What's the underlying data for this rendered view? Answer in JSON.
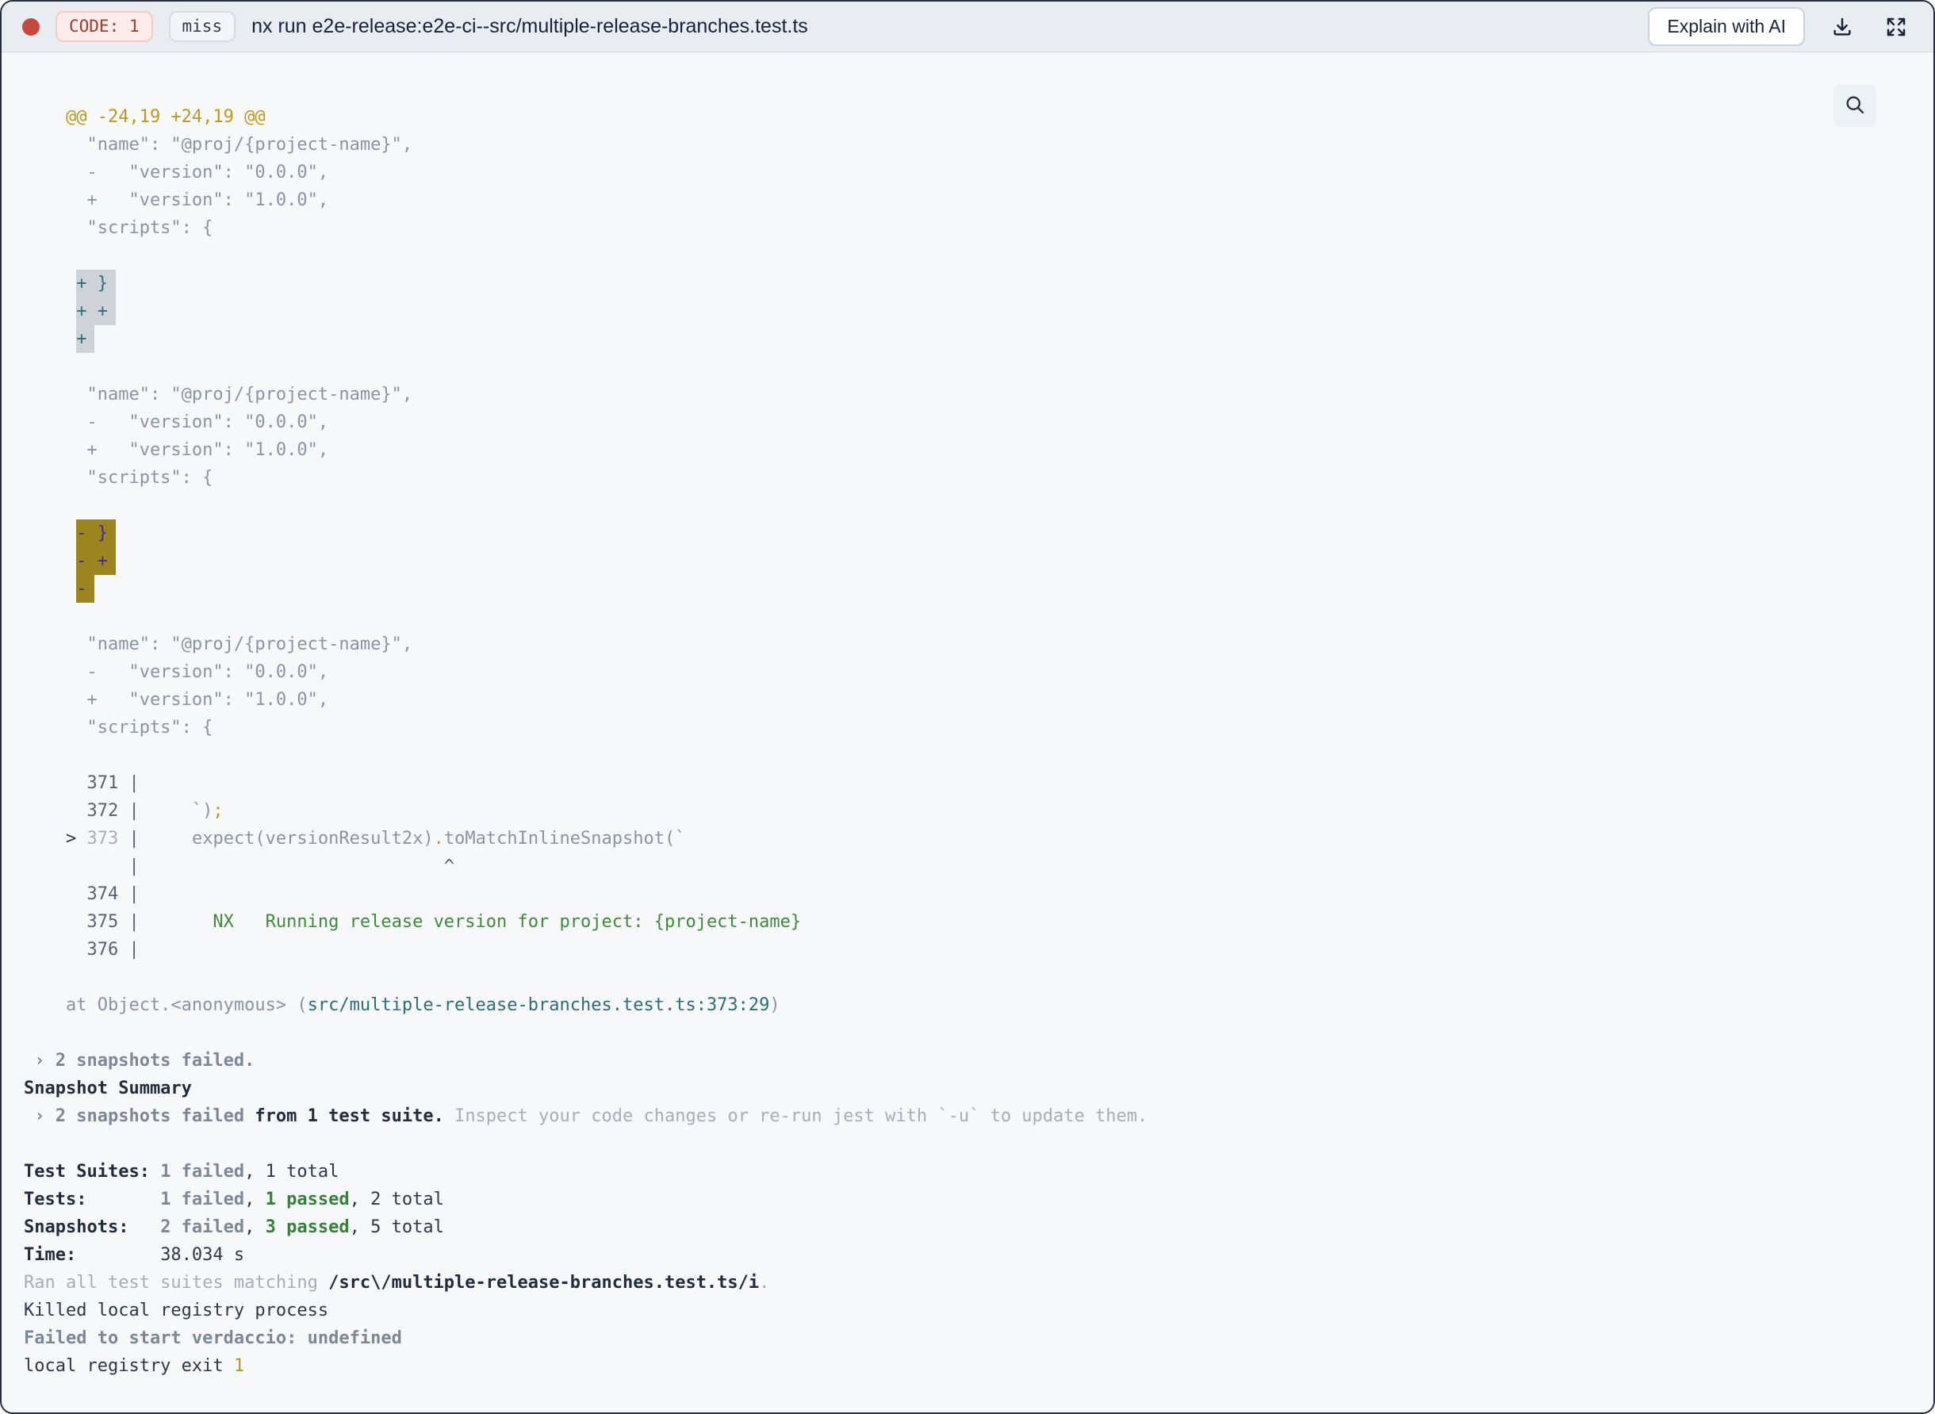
{
  "header": {
    "code_badge": "CODE: 1",
    "cache_badge": "miss",
    "title": "nx run e2e-release:e2e-ci--src/multiple-release-branches.test.ts",
    "explain_button": "Explain with AI",
    "status_dot_color": "#c6483e"
  },
  "colors": {
    "header_bg": "#e9edf2",
    "terminal_bg": "#f7f8fa",
    "diff_yellow": "#bd9821",
    "pass_green": "#35803a",
    "link_teal": "#2c6d78",
    "match_highlight_bg": "#ced3da",
    "active_match_highlight_bg": "#9c8420",
    "badge_red_text": "#9e3a30"
  },
  "terminal": {
    "lines": [
      {
        "name": "diff-hunk-header",
        "s": [
          {
            "t": "    @@ -24,19 +24,19 @@",
            "c": "y"
          }
        ]
      },
      {
        "name": "diff-line",
        "s": [
          {
            "t": "      \"name\": \"@proj/{project-name}\",",
            "c": "g"
          }
        ]
      },
      {
        "name": "diff-line",
        "s": [
          {
            "t": "      -   \"version\": \"0.0.0\",",
            "c": "g"
          }
        ]
      },
      {
        "name": "diff-line",
        "s": [
          {
            "t": "      +   \"version\": \"1.0.0\",",
            "c": "g"
          }
        ]
      },
      {
        "name": "diff-line",
        "s": [
          {
            "t": "      \"scripts\": {",
            "c": "g"
          }
        ]
      },
      {
        "name": "blank-line",
        "s": []
      },
      {
        "name": "search-match-line",
        "s": [
          {
            "t": "     ",
            "c": "g"
          },
          {
            "t": "+ }",
            "c": "hlg"
          }
        ]
      },
      {
        "name": "search-match-line",
        "s": [
          {
            "t": "     ",
            "c": "g"
          },
          {
            "t": "+ +",
            "c": "hlg"
          }
        ]
      },
      {
        "name": "search-match-line",
        "s": [
          {
            "t": "     ",
            "c": "g"
          },
          {
            "t": "+",
            "c": "hlg"
          }
        ]
      },
      {
        "name": "blank-line",
        "s": []
      },
      {
        "name": "diff-line",
        "s": [
          {
            "t": "      \"name\": \"@proj/{project-name}\",",
            "c": "g"
          }
        ]
      },
      {
        "name": "diff-line",
        "s": [
          {
            "t": "      -   \"version\": \"0.0.0\",",
            "c": "g"
          }
        ]
      },
      {
        "name": "diff-line",
        "s": [
          {
            "t": "      +   \"version\": \"1.0.0\",",
            "c": "g"
          }
        ]
      },
      {
        "name": "diff-line",
        "s": [
          {
            "t": "      \"scripts\": {",
            "c": "g"
          }
        ]
      },
      {
        "name": "blank-line",
        "s": []
      },
      {
        "name": "active-search-match-line",
        "s": [
          {
            "t": "     ",
            "c": "g"
          },
          {
            "t": "- }",
            "c": "hlo"
          }
        ]
      },
      {
        "name": "active-search-match-line",
        "s": [
          {
            "t": "     ",
            "c": "g"
          },
          {
            "t": "- +",
            "c": "hlo"
          }
        ]
      },
      {
        "name": "active-search-match-line",
        "s": [
          {
            "t": "     ",
            "c": "g"
          },
          {
            "t": "-",
            "c": "hlo"
          }
        ]
      },
      {
        "name": "blank-line",
        "s": []
      },
      {
        "name": "diff-line",
        "s": [
          {
            "t": "      \"name\": \"@proj/{project-name}\",",
            "c": "g"
          }
        ]
      },
      {
        "name": "diff-line",
        "s": [
          {
            "t": "      -   \"version\": \"0.0.0\",",
            "c": "g"
          }
        ]
      },
      {
        "name": "diff-line",
        "s": [
          {
            "t": "      +   \"version\": \"1.0.0\",",
            "c": "g"
          }
        ]
      },
      {
        "name": "diff-line",
        "s": [
          {
            "t": "      \"scripts\": {",
            "c": "g"
          }
        ]
      },
      {
        "name": "blank-line",
        "s": []
      },
      {
        "name": "code-frame-line",
        "s": [
          {
            "t": "      371 |",
            "c": "ln"
          }
        ]
      },
      {
        "name": "code-frame-line",
        "s": [
          {
            "t": "      372 |",
            "c": "ln"
          },
          {
            "t": "     `)",
            "c": "g"
          },
          {
            "t": ";",
            "c": "y"
          }
        ]
      },
      {
        "name": "code-frame-error-line",
        "s": [
          {
            "t": "    > ",
            "c": "d"
          },
          {
            "t": "373",
            "c": "dim"
          },
          {
            "t": " |",
            "c": "ln"
          },
          {
            "t": "     expect(versionResult2x)",
            "c": "g"
          },
          {
            "t": ".",
            "c": "y"
          },
          {
            "t": "toMatchInlineSnapshot(`",
            "c": "g"
          }
        ]
      },
      {
        "name": "code-frame-caret-line",
        "s": [
          {
            "t": "          |                             ^",
            "c": "ln"
          }
        ]
      },
      {
        "name": "code-frame-line",
        "s": [
          {
            "t": "      374 |",
            "c": "ln"
          }
        ]
      },
      {
        "name": "code-frame-line",
        "s": [
          {
            "t": "      375 |",
            "c": "ln"
          },
          {
            "t": "       NX   Running release version for project: {project-name}",
            "c": "gr"
          }
        ]
      },
      {
        "name": "code-frame-line",
        "s": [
          {
            "t": "      376 |",
            "c": "ln"
          }
        ]
      },
      {
        "name": "blank-line",
        "s": []
      },
      {
        "name": "stack-trace-line",
        "s": [
          {
            "t": "    at Object.<anonymous> (",
            "c": "g"
          },
          {
            "t": "src/multiple-release-branches.test.ts:373:29",
            "c": "t"
          },
          {
            "t": ")",
            "c": "g"
          }
        ]
      },
      {
        "name": "blank-line",
        "s": []
      },
      {
        "name": "snapshots-failed-line",
        "s": [
          {
            "t": " › 2 snapshots failed.",
            "c": "gb"
          }
        ]
      },
      {
        "name": "snapshot-summary-heading",
        "s": [
          {
            "t": "Snapshot Summary",
            "c": "db"
          }
        ]
      },
      {
        "name": "snapshot-summary-line",
        "s": [
          {
            "t": " › 2 snapshots failed",
            "c": "gb"
          },
          {
            "t": " from 1 test suite.",
            "c": "db"
          },
          {
            "t": " Inspect your code changes or re-run jest with `-u` to update them.",
            "c": "dim"
          }
        ]
      },
      {
        "name": "blank-line",
        "s": []
      },
      {
        "name": "test-suites-line",
        "s": [
          {
            "t": "Test Suites: ",
            "c": "db"
          },
          {
            "t": "1 failed",
            "c": "gb"
          },
          {
            "t": ", 1 total",
            "c": "d"
          }
        ]
      },
      {
        "name": "tests-line",
        "s": [
          {
            "t": "Tests:       ",
            "c": "db"
          },
          {
            "t": "1 failed",
            "c": "gb"
          },
          {
            "t": ", ",
            "c": "d"
          },
          {
            "t": "1 passed",
            "c": "grb"
          },
          {
            "t": ", 2 total",
            "c": "d"
          }
        ]
      },
      {
        "name": "snapshots-line",
        "s": [
          {
            "t": "Snapshots:   ",
            "c": "db"
          },
          {
            "t": "2 failed",
            "c": "gb"
          },
          {
            "t": ", ",
            "c": "d"
          },
          {
            "t": "3 passed",
            "c": "grb"
          },
          {
            "t": ", 5 total",
            "c": "d"
          }
        ]
      },
      {
        "name": "time-line",
        "s": [
          {
            "t": "Time:        ",
            "c": "db"
          },
          {
            "t": "38.034 s",
            "c": "d"
          }
        ]
      },
      {
        "name": "ran-all-suites-line",
        "s": [
          {
            "t": "Ran all test suites matching ",
            "c": "dim"
          },
          {
            "t": "/src\\/multiple-release-branches.test.ts/i",
            "c": "db"
          },
          {
            "t": ".",
            "c": "dim"
          }
        ]
      },
      {
        "name": "log-line",
        "s": [
          {
            "t": "Killed local registry process",
            "c": "d"
          }
        ]
      },
      {
        "name": "log-line",
        "s": [
          {
            "t": "Failed to start verdaccio: undefined",
            "c": "gb"
          }
        ]
      },
      {
        "name": "log-line",
        "s": [
          {
            "t": "local registry exit ",
            "c": "d"
          },
          {
            "t": "1",
            "c": "y"
          }
        ]
      }
    ]
  }
}
